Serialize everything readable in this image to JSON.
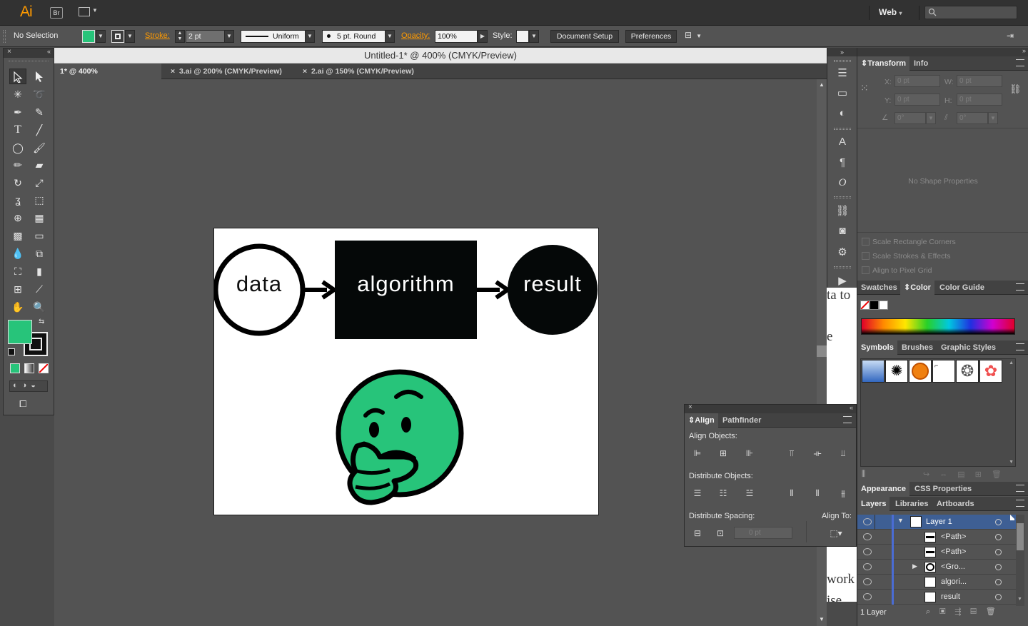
{
  "app": {
    "logo": "Ai",
    "bridge_label": "Br",
    "workspace_label": "Web",
    "search_placeholder": ""
  },
  "control_bar": {
    "selection_label": "No Selection",
    "stroke_label": "Stroke:",
    "stroke_value": "2 pt",
    "profile_value": "Uniform",
    "brush_value": "5 pt. Round",
    "opacity_label": "Opacity:",
    "opacity_value": "100%",
    "style_label": "Style:",
    "document_setup_label": "Document Setup",
    "preferences_label": "Preferences",
    "fill_color": "#27c47a"
  },
  "document": {
    "window_title": "Untitled-1* @ 400% (CMYK/Preview)",
    "tabs": [
      {
        "label": "1* @ 400% (CMYK/Preview)",
        "active": true
      },
      {
        "label": "3.ai @ 200% (CMYK/Preview)",
        "active": false
      },
      {
        "label": "2.ai @ 150% (CMYK/Preview)",
        "active": false
      }
    ],
    "close_glyph": "×"
  },
  "artwork": {
    "node_data": "data",
    "node_algorithm": "algorithm",
    "node_result": "result",
    "emoji_color": "#27c47a"
  },
  "background_text": {
    "line1": "ta to",
    "line2": "e",
    "line3": "work",
    "line4": "ise."
  },
  "transform_panel": {
    "tab_transform": "Transform",
    "tab_info": "Info",
    "x_label": "X:",
    "y_label": "Y:",
    "w_label": "W:",
    "h_label": "H:",
    "x_value": "0 pt",
    "y_value": "0 pt",
    "w_value": "0 pt",
    "h_value": "0 pt",
    "angle_value": "0°",
    "shear_value": "0°",
    "no_shape": "No Shape Properties",
    "scale_corners": "Scale Rectangle Corners",
    "scale_strokes": "Scale Strokes & Effects",
    "align_pixel": "Align to Pixel Grid"
  },
  "color_panel": {
    "tab_swatches": "Swatches",
    "tab_color": "Color",
    "tab_color_guide": "Color Guide"
  },
  "symbols_panel": {
    "tab_symbols": "Symbols",
    "tab_brushes": "Brushes",
    "tab_graphic_styles": "Graphic Styles"
  },
  "appearance_panel": {
    "tab_appearance": "Appearance",
    "tab_css": "CSS Properties"
  },
  "layers_panel": {
    "tab_layers": "Layers",
    "tab_libraries": "Libraries",
    "tab_artboards": "Artboards",
    "rows": [
      {
        "name": "Layer 1"
      },
      {
        "name": "<Path>"
      },
      {
        "name": "<Path>"
      },
      {
        "name": "<Gro..."
      },
      {
        "name": "algori..."
      },
      {
        "name": "result"
      }
    ],
    "footer_count": "1 Layer"
  },
  "align_panel": {
    "tab_align": "Align",
    "tab_pathfinder": "Pathfinder",
    "align_objects": "Align Objects:",
    "distribute_objects": "Distribute Objects:",
    "distribute_spacing": "Distribute Spacing:",
    "align_to": "Align To:",
    "spacing_value": "0 pt"
  }
}
